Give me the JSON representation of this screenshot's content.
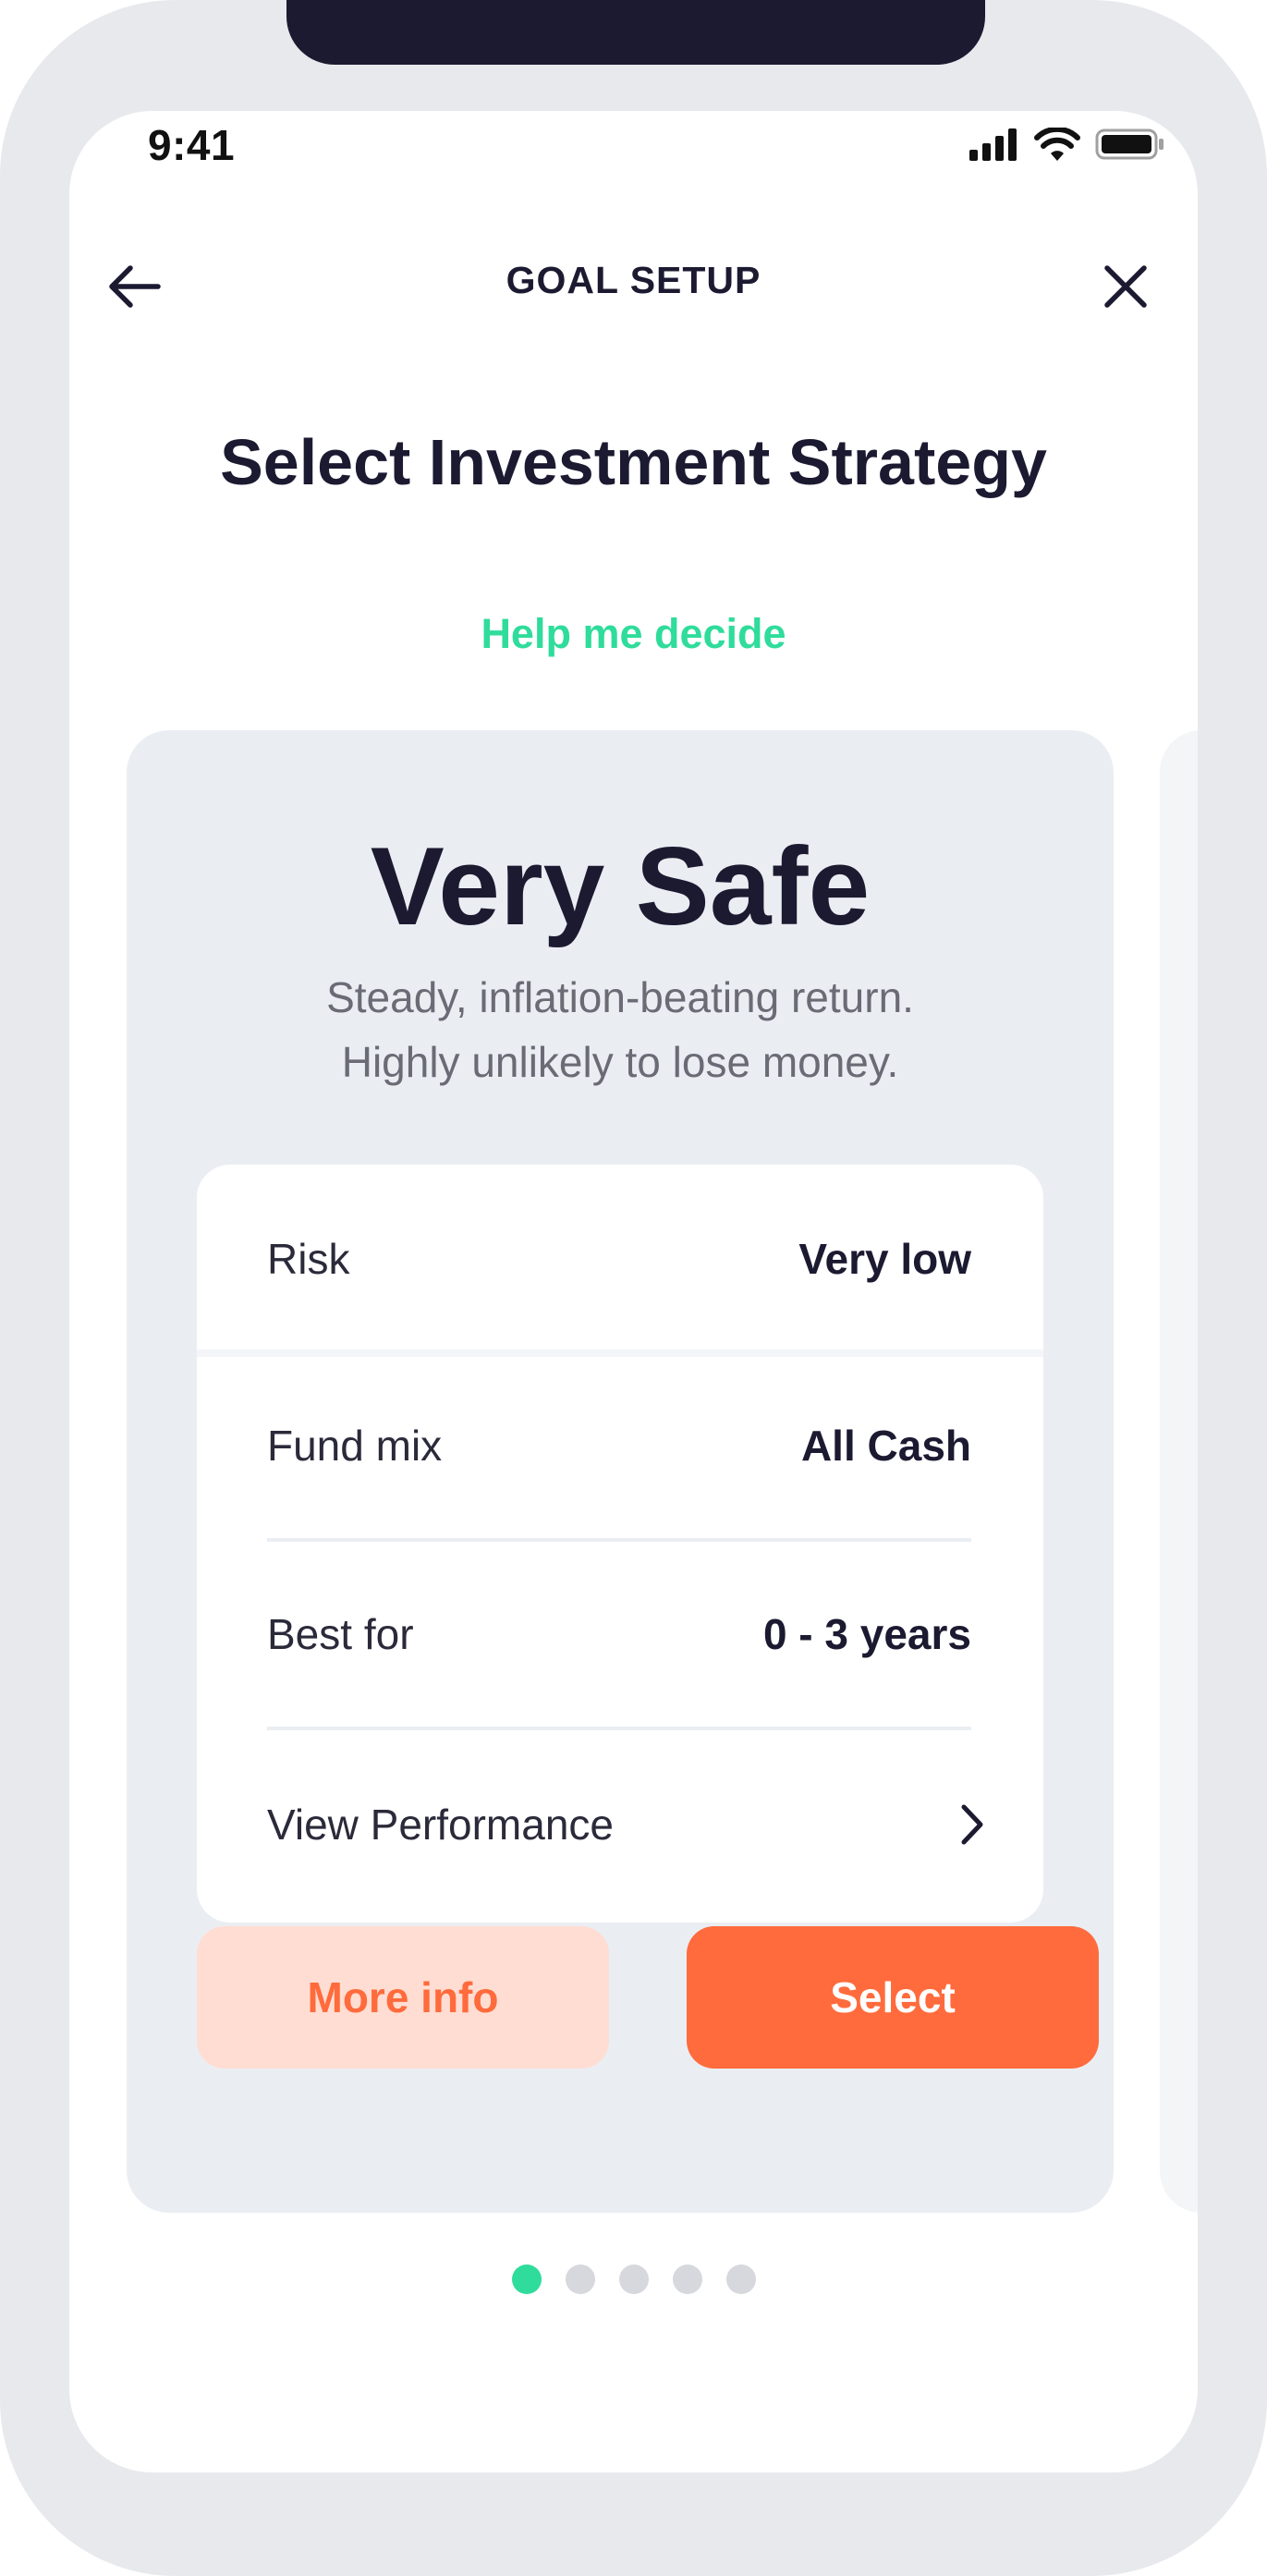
{
  "status_bar": {
    "time": "9:41",
    "icons": [
      "cellular-signal-icon",
      "wifi-icon",
      "battery-icon"
    ]
  },
  "header": {
    "title": "GOAL SETUP",
    "back_icon": "arrow-left-icon",
    "close_icon": "close-icon"
  },
  "page": {
    "title": "Select Investment Strategy",
    "help_link": "Help me decide"
  },
  "strategy_card": {
    "name": "Very Safe",
    "description_line1": "Steady, inflation-beating return.",
    "description_line2": "Highly unlikely to lose money.",
    "details": [
      {
        "label": "Risk",
        "value": "Very low"
      },
      {
        "label": "Fund mix",
        "value": "All Cash"
      },
      {
        "label": "Best for",
        "value": "0 - 3 years"
      }
    ],
    "performance_link": "View Performance",
    "more_info_label": "More info",
    "select_label": "Select"
  },
  "pagination": {
    "total": 5,
    "active_index": 0
  },
  "colors": {
    "accent_green": "#2fdc9b",
    "accent_orange": "#ff6b3c",
    "orange_light": "#ffddd2",
    "text_dark": "#1c1a31",
    "card_bg": "#eaeef3"
  }
}
